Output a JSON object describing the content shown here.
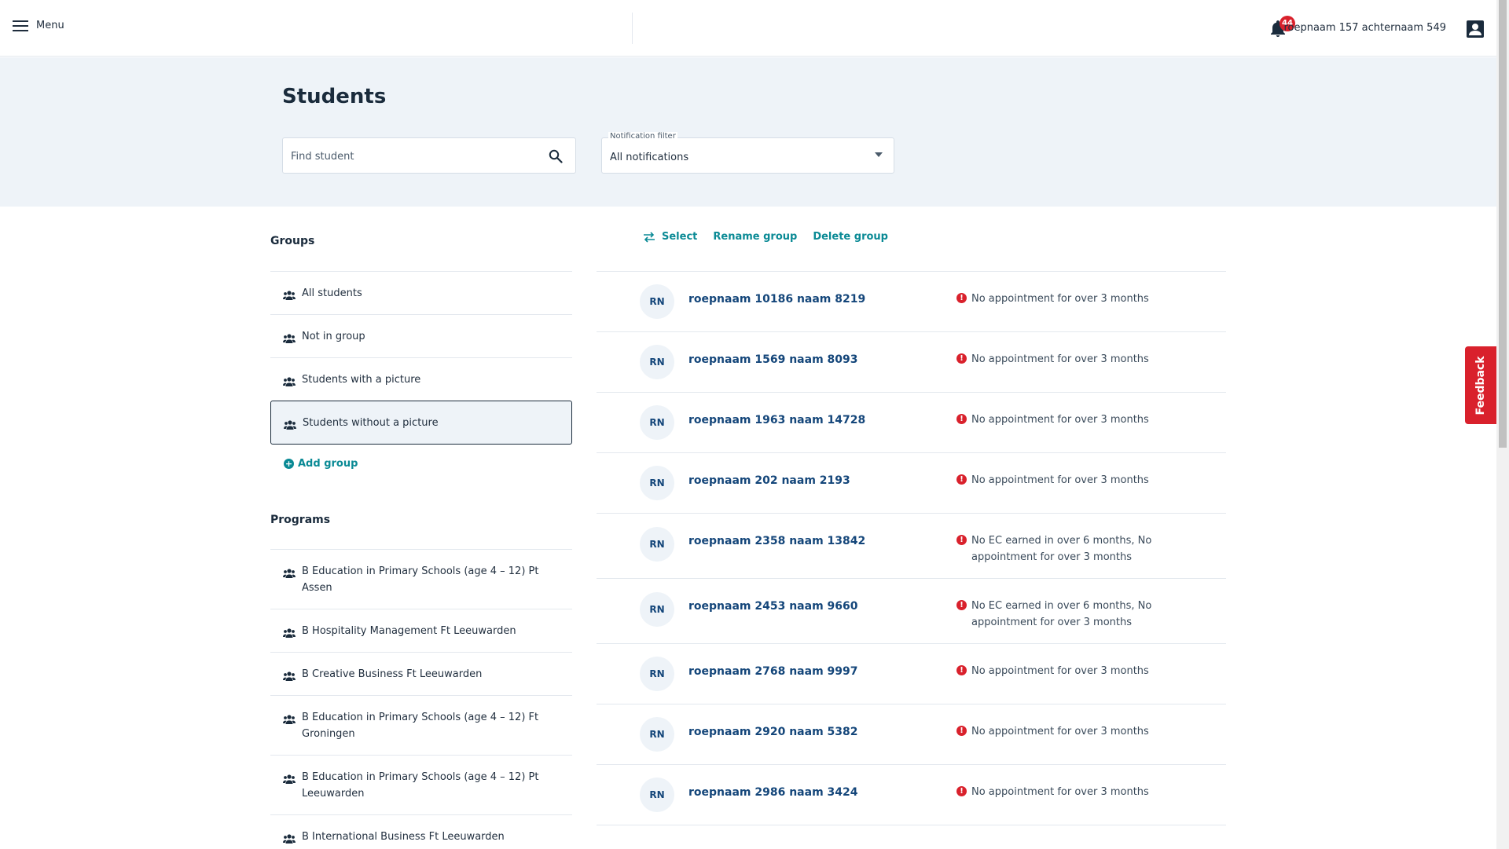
{
  "header": {
    "menu_label": "Menu",
    "notification_count": "44",
    "user_name": "roepnaam 157 achternaam 549"
  },
  "page": {
    "title": "Students",
    "search_placeholder": "Find student",
    "filter_label": "Notification filter",
    "filter_value": "All notifications"
  },
  "groups": {
    "title": "Groups",
    "items": [
      {
        "label": "All students",
        "selected": false
      },
      {
        "label": "Not in group",
        "selected": false
      },
      {
        "label": "Students with a picture",
        "selected": false
      },
      {
        "label": "Students without a picture",
        "selected": true
      }
    ],
    "add_label": "Add group"
  },
  "programs": {
    "title": "Programs",
    "items": [
      "B Education in Primary Schools (age 4 – 12) Pt Assen",
      "B Hospitality Management Ft Leeuwarden",
      "B Creative Business Ft Leeuwarden",
      "B Education in Primary Schools (age 4 – 12) Ft Groningen",
      "B Education in Primary Schools (age 4 – 12) Pt Leeuwarden",
      "B International Business Ft Leeuwarden"
    ]
  },
  "actions": {
    "select": "Select",
    "rename": "Rename group",
    "delete": "Delete group"
  },
  "students": [
    {
      "initials": "RN",
      "name": "roepnaam 10186 naam 8219",
      "alert": "No appointment for over 3 months"
    },
    {
      "initials": "RN",
      "name": "roepnaam 1569 naam 8093",
      "alert": "No appointment for over 3 months"
    },
    {
      "initials": "RN",
      "name": "roepnaam 1963 naam 14728",
      "alert": "No appointment for over 3 months"
    },
    {
      "initials": "RN",
      "name": "roepnaam 202 naam 2193",
      "alert": "No appointment for over 3 months"
    },
    {
      "initials": "RN",
      "name": "roepnaam 2358 naam 13842",
      "alert": "No EC earned in over 6 months, No appointment for over 3 months"
    },
    {
      "initials": "RN",
      "name": "roepnaam 2453 naam 9660",
      "alert": "No EC earned in over 6 months, No appointment for over 3 months"
    },
    {
      "initials": "RN",
      "name": "roepnaam 2768 naam 9997",
      "alert": "No appointment for over 3 months"
    },
    {
      "initials": "RN",
      "name": "roepnaam 2920 naam 5382",
      "alert": "No appointment for over 3 months"
    },
    {
      "initials": "RN",
      "name": "roepnaam 2986 naam 3424",
      "alert": "No appointment for over 3 months"
    }
  ],
  "feedback_label": "Feedback",
  "colors": {
    "accent_teal": "#0a8a95",
    "link_blue": "#14467a",
    "alert_red": "#d9212c",
    "header_band": "#eef3f8"
  },
  "icons": {
    "menu": "hamburger-icon",
    "notifications": "bell-icon",
    "user": "user-icon",
    "search": "search-icon",
    "group": "people-icon",
    "add": "plus-circle-icon",
    "select": "swap-arrows-icon",
    "alert": "exclamation-circle-icon"
  }
}
